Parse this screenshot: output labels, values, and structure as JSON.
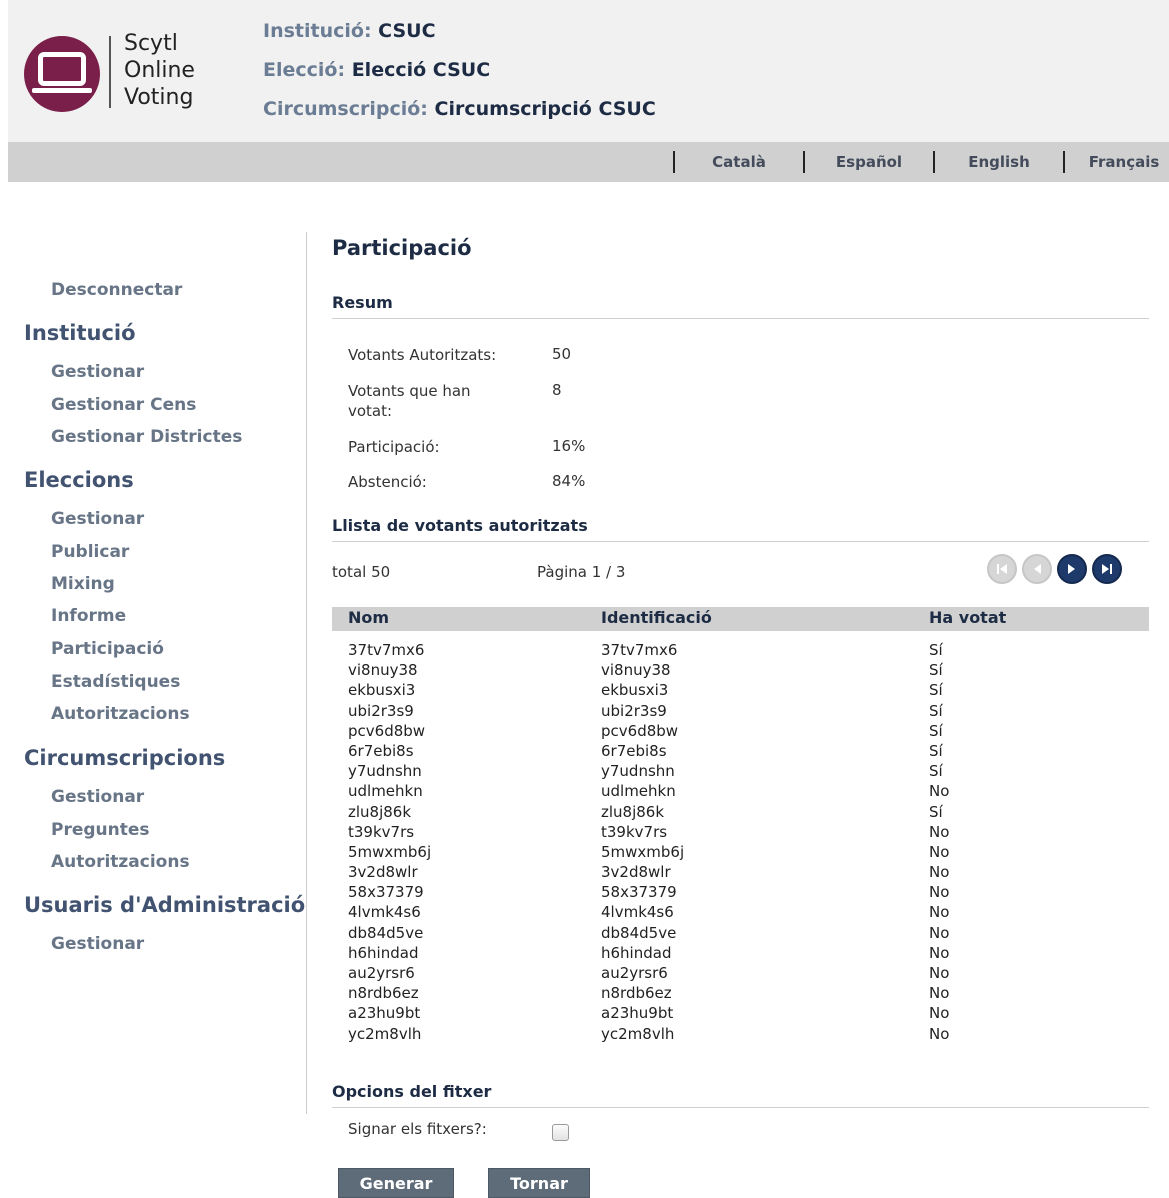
{
  "header": {
    "logo_lines": [
      "Scytl",
      "Online",
      "Voting"
    ],
    "institution_label": "Institució:",
    "institution_value": "CSUC",
    "election_label": "Elecció:",
    "election_value": "Elecció CSUC",
    "circumscription_label": "Circumscripció:",
    "circumscription_value": "Circumscripció CSUC"
  },
  "languages": [
    "Català",
    "Español",
    "English",
    "Français"
  ],
  "sidebar": {
    "logout": "Desconnectar",
    "sections": [
      {
        "title": "Institució",
        "items": [
          "Gestionar",
          "Gestionar Cens",
          "Gestionar Districtes"
        ]
      },
      {
        "title": "Eleccions",
        "items": [
          "Gestionar",
          "Publicar",
          "Mixing",
          "Informe",
          "Participació",
          "Estadístiques",
          "Autoritzacions"
        ]
      },
      {
        "title": "Circumscripcions",
        "items": [
          "Gestionar",
          "Preguntes",
          "Autoritzacions"
        ]
      },
      {
        "title": "Usuaris d'Administració",
        "items": [
          "Gestionar"
        ]
      }
    ]
  },
  "main": {
    "title": "Participació",
    "summary_heading": "Resum",
    "summary": [
      {
        "label": "Votants Autoritzats:",
        "value": "50"
      },
      {
        "label": "Votants que han votat:",
        "value": "8"
      },
      {
        "label": "Participació:",
        "value": "16%"
      },
      {
        "label": "Abstenció:",
        "value": "84%"
      }
    ],
    "list_heading": "Llista de votants autoritzats",
    "total": "total 50",
    "page_info": "Pàgina 1 / 3",
    "pager_icons": [
      "first-page-icon",
      "prev-page-icon",
      "next-page-icon",
      "last-page-icon"
    ],
    "columns": [
      "Nom",
      "Identificació",
      "Ha votat"
    ],
    "rows": [
      [
        "37tv7mx6",
        "37tv7mx6",
        "Sí"
      ],
      [
        "vi8nuy38",
        "vi8nuy38",
        "Sí"
      ],
      [
        "ekbusxi3",
        "ekbusxi3",
        "Sí"
      ],
      [
        "ubi2r3s9",
        "ubi2r3s9",
        "Sí"
      ],
      [
        "pcv6d8bw",
        "pcv6d8bw",
        "Sí"
      ],
      [
        "6r7ebi8s",
        "6r7ebi8s",
        "Sí"
      ],
      [
        "y7udnshn",
        "y7udnshn",
        "Sí"
      ],
      [
        "udlmehkn",
        "udlmehkn",
        "No"
      ],
      [
        "zlu8j86k",
        "zlu8j86k",
        "Sí"
      ],
      [
        "t39kv7rs",
        "t39kv7rs",
        "No"
      ],
      [
        "5mwxmb6j",
        "5mwxmb6j",
        "No"
      ],
      [
        "3v2d8wlr",
        "3v2d8wlr",
        "No"
      ],
      [
        "58x37379",
        "58x37379",
        "No"
      ],
      [
        "4lvmk4s6",
        "4lvmk4s6",
        "No"
      ],
      [
        "db84d5ve",
        "db84d5ve",
        "No"
      ],
      [
        "h6hindad",
        "h6hindad",
        "No"
      ],
      [
        "au2yrsr6",
        "au2yrsr6",
        "No"
      ],
      [
        "n8rdb6ez",
        "n8rdb6ez",
        "No"
      ],
      [
        "a23hu9bt",
        "a23hu9bt",
        "No"
      ],
      [
        "yc2m8vlh",
        "yc2m8vlh",
        "No"
      ]
    ],
    "file_options_heading": "Opcions del fitxer",
    "sign_label": "Signar els fitxers?:",
    "sign_checked": false,
    "generate_button": "Generar",
    "back_button": "Tornar"
  },
  "colors": {
    "brand": "#7a1e4a",
    "header_bg": "#f1f1f1",
    "langbar_bg": "#d0d0d0",
    "table_head_bg": "#d0d0d0",
    "button_bg": "#5e6b79",
    "pager_active": "#1d3a6b"
  }
}
